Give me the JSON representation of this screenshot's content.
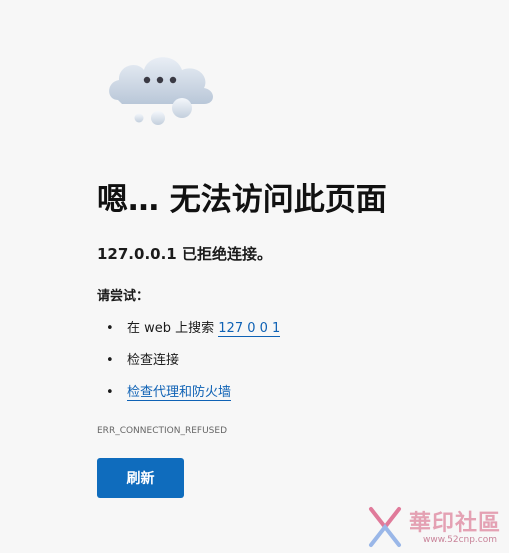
{
  "error_page": {
    "title": "嗯… 无法访问此页面",
    "message": "127.0.0.1 已拒绝连接。",
    "try_heading": "请尝试：",
    "suggestions": [
      {
        "prefix": "在 web 上搜索 ",
        "link": "127 0 0 1"
      },
      {
        "prefix": "检查连接",
        "link": ""
      },
      {
        "prefix": "",
        "link": "检查代理和防火墙"
      }
    ],
    "bullet": "•",
    "error_code": "ERR_CONNECTION_REFUSED",
    "refresh_label": "刷新"
  },
  "watermark": {
    "text": "華印社區",
    "url": "www.52cnp.com"
  },
  "colors": {
    "accent": "#0f6cbd",
    "link": "#0f62b5",
    "background": "#f7f7f7"
  },
  "icons": {
    "cloud": "sad-cloud-icon",
    "watermark_logo": "watermark-logo-icon"
  }
}
